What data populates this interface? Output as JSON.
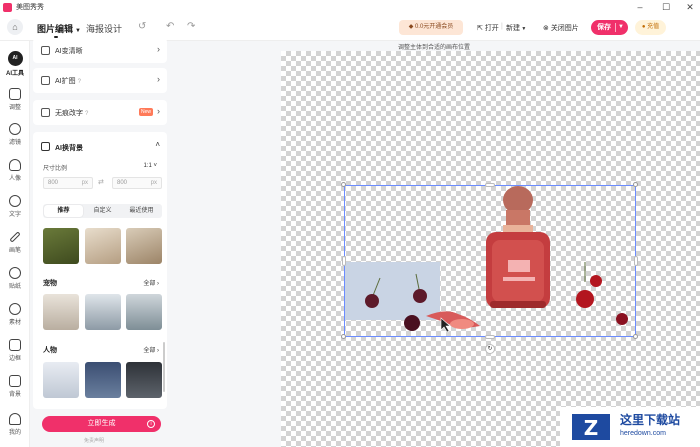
{
  "window": {
    "title": "美图秀秀"
  },
  "toolbar": {
    "tab_edit": "图片编辑",
    "tab_poster": "海报设计",
    "vip": "0.0元开通会员",
    "open": "打开",
    "new": "新建",
    "close_image": "关闭图片",
    "save": "保存",
    "coins": "充值"
  },
  "nav": {
    "ai_mark": "AI",
    "items": [
      "AI工具",
      "调整",
      "滤镜",
      "人像",
      "文字",
      "画笔",
      "贴纸",
      "素材",
      "边框",
      "背景",
      "我的"
    ]
  },
  "panel": {
    "rows": [
      "AI变清晰",
      "AI扩图",
      "无痕改字"
    ],
    "new_badge": "New",
    "bg": {
      "title": "AI换背景",
      "ratio_label": "尺寸比例",
      "ratio_value": "1:1",
      "width": "800",
      "height": "800",
      "unit": "px",
      "tabs": [
        "推荐",
        "自定义",
        "最近使用"
      ],
      "section_pet": "宠物",
      "section_person": "人物",
      "all": "全部"
    },
    "generate": "立即生成",
    "disclaimer": "免责声明"
  },
  "canvas": {
    "hint": "调整主体到合适的画布位置"
  },
  "watermark": {
    "title": "这里下载站",
    "url": "heredown.com",
    "logo_letter": "Z"
  }
}
